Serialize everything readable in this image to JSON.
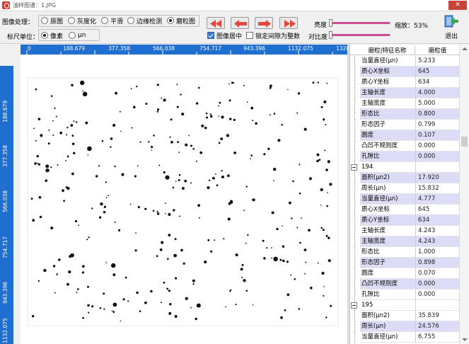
{
  "window": {
    "title": "油样图谱：1.JPG",
    "close_label": "✕"
  },
  "toolbar": {
    "image_process_label": "图像处理：",
    "process_options": [
      {
        "label": "原图",
        "selected": false
      },
      {
        "label": "灰度化",
        "selected": false
      },
      {
        "label": "平滑",
        "selected": false
      },
      {
        "label": "边缘检测",
        "selected": false
      },
      {
        "label": "磨粒图",
        "selected": true
      }
    ],
    "unit_label": "标尺单位：",
    "unit_options": [
      {
        "label": "像素",
        "selected": true
      },
      {
        "label": "μn",
        "selected": false
      }
    ],
    "center_image": {
      "label": "图像居中",
      "checked": true
    },
    "lock_interval": {
      "label": "锁定间隙为整数",
      "checked": false
    },
    "brightness_label": "亮度",
    "contrast_label": "对比度",
    "zoom_label": "缩放：53%",
    "exit_label": "退出",
    "brightness_level": 0.0,
    "contrast_level": 0.0,
    "accent_color": "#1e6fd0"
  },
  "ruler": {
    "h_labels": [
      "0",
      "188.679",
      "377.358",
      "566.038",
      "754.717",
      "943.396",
      "1132.075",
      "1320"
    ],
    "v_labels": [
      "188.679",
      "377.358",
      "566.038",
      "754.717",
      "943.396",
      "1132.075"
    ]
  },
  "panel": {
    "col_name": "磨粒|特征名称",
    "col_value": "磨粒值",
    "rows": [
      {
        "name": "当量直径(μn)",
        "value": "5.233",
        "alt": false,
        "group": false
      },
      {
        "name": "质心X坐标",
        "value": "645",
        "alt": true,
        "group": false
      },
      {
        "name": "质心Y坐标",
        "value": "634",
        "alt": false,
        "group": false
      },
      {
        "name": "主轴长度",
        "value": "4.000",
        "alt": true,
        "group": false
      },
      {
        "name": "主轴宽度",
        "value": "5.000",
        "alt": false,
        "group": false
      },
      {
        "name": "形态比",
        "value": "0.800",
        "alt": true,
        "group": false
      },
      {
        "name": "形态因子",
        "value": "0.799",
        "alt": false,
        "group": false
      },
      {
        "name": "圆度",
        "value": "0.107",
        "alt": true,
        "group": false
      },
      {
        "name": "凸凹不规则度",
        "value": "0.000",
        "alt": false,
        "group": false
      },
      {
        "name": "孔隙比",
        "value": "0.000",
        "alt": true,
        "group": false
      },
      {
        "name": "194",
        "value": "",
        "alt": false,
        "group": true
      },
      {
        "name": "面积(μn2)",
        "value": "17.920",
        "alt": true,
        "group": false
      },
      {
        "name": "周长(μn)",
        "value": "15.832",
        "alt": false,
        "group": false
      },
      {
        "name": "当量直径(μn)",
        "value": "4.777",
        "alt": true,
        "group": false
      },
      {
        "name": "质心X坐标",
        "value": "645",
        "alt": false,
        "group": false
      },
      {
        "name": "质心Y坐标",
        "value": "634",
        "alt": true,
        "group": false
      },
      {
        "name": "主轴长度",
        "value": "4.243",
        "alt": false,
        "group": false
      },
      {
        "name": "主轴宽度",
        "value": "4.243",
        "alt": true,
        "group": false
      },
      {
        "name": "形态比",
        "value": "1.000",
        "alt": false,
        "group": false
      },
      {
        "name": "形态因子",
        "value": "0.898",
        "alt": true,
        "group": false
      },
      {
        "name": "圆度",
        "value": "0.070",
        "alt": false,
        "group": false
      },
      {
        "name": "凸凹不规则度",
        "value": "0.000",
        "alt": true,
        "group": false
      },
      {
        "name": "孔隙比",
        "value": "0.000",
        "alt": false,
        "group": false
      },
      {
        "name": "195",
        "value": "",
        "alt": false,
        "group": true
      },
      {
        "name": "面积(μn2)",
        "value": "35.839",
        "alt": false,
        "group": false
      },
      {
        "name": "周长(μn)",
        "value": "24.576",
        "alt": true,
        "group": false
      },
      {
        "name": "当量直径(μn)",
        "value": "6.755",
        "alt": false,
        "group": false
      }
    ]
  }
}
